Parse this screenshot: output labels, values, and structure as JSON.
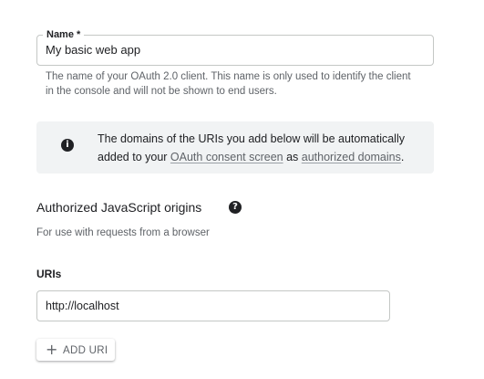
{
  "name_field": {
    "label": "Name *",
    "value": "My basic web app",
    "helper": "The name of your OAuth 2.0 client. This name is only used to identify the client in the console and will not be shown to end users."
  },
  "info_notice": {
    "icon": "info-icon",
    "text_before": "The domains of the URIs you add below will be automatically added to your ",
    "link1": "OAuth consent screen",
    "text_middle": " as ",
    "link2": "authorized domains",
    "text_after": "."
  },
  "js_origins": {
    "title": "Authorized JavaScript origins",
    "help_icon": "help-icon",
    "subtitle": "For use with requests from a browser",
    "uris_label": "URIs",
    "uri_value": "http://localhost",
    "add_button": "ADD URI"
  }
}
